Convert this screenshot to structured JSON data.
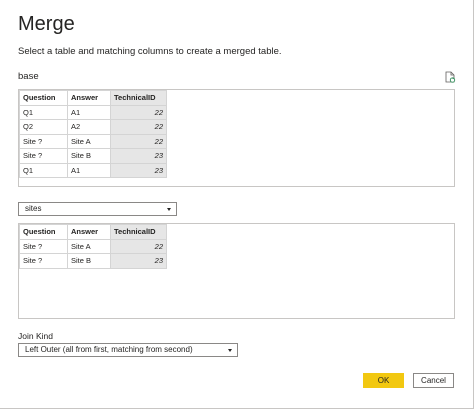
{
  "dialog": {
    "title": "Merge",
    "subtitle": "Select a table and matching columns to create a merged table."
  },
  "first_table": {
    "name": "base",
    "headers": [
      "Question",
      "Answer",
      "TechnicalID"
    ],
    "rows": [
      [
        "Q1",
        "A1",
        "22"
      ],
      [
        "Q2",
        "A2",
        "22"
      ],
      [
        "Site ?",
        "Site A",
        "22"
      ],
      [
        "Site ?",
        "Site B",
        "23"
      ],
      [
        "Q1",
        "A1",
        "23"
      ]
    ]
  },
  "second_table": {
    "selected": "sites",
    "headers": [
      "Question",
      "Answer",
      "TechnicalID"
    ],
    "rows": [
      [
        "Site ?",
        "Site A",
        "22"
      ],
      [
        "Site ?",
        "Site B",
        "23"
      ]
    ]
  },
  "join": {
    "label": "Join Kind",
    "selected": "Left Outer (all from first, matching from second)"
  },
  "buttons": {
    "ok": "OK",
    "cancel": "Cancel"
  },
  "colors": {
    "accent": "#f2c811",
    "selected_column": "#e6e6e6"
  },
  "icons": {
    "refresh": "refresh-preview-icon",
    "dropdown": "chevron-down-icon"
  }
}
